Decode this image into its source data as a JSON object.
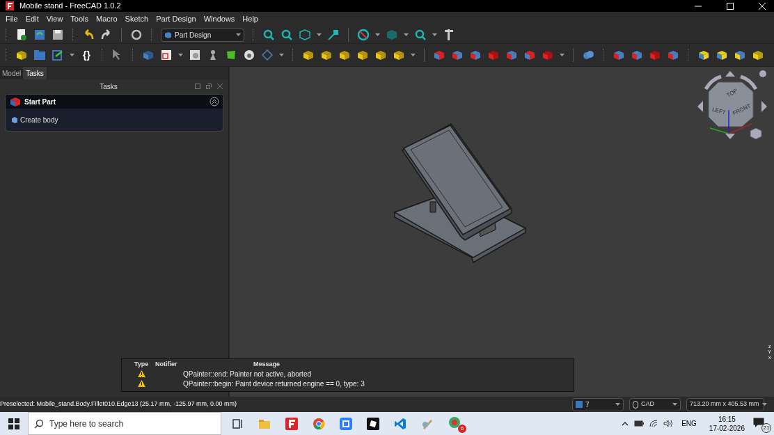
{
  "window": {
    "title": "Mobile stand - FreeCAD 1.0.2"
  },
  "menu": [
    "File",
    "Edit",
    "View",
    "Tools",
    "Macro",
    "Sketch",
    "Part Design",
    "Windows",
    "Help"
  ],
  "workbench": {
    "value": "Part Design"
  },
  "macro_button": "{}",
  "combo_tabs": [
    {
      "label": "Model",
      "selected": false
    },
    {
      "label": "Tasks",
      "selected": true
    }
  ],
  "task_panel": {
    "title": "Tasks",
    "box_title": "Start Part",
    "expanded": true,
    "action": "Create body"
  },
  "navigation_cube": {
    "faces": [
      "TOP",
      "LEFT",
      "FRONT"
    ]
  },
  "axis_labels": [
    "z",
    "Y",
    "x"
  ],
  "report": {
    "columns": [
      "Type",
      "Notifier",
      "Message"
    ],
    "rows": [
      {
        "kind": "warning",
        "message": "QPainter::end: Painter not active, aborted"
      },
      {
        "kind": "warning",
        "message": "QPainter::begin: Paint device returned engine == 0, type: 3"
      }
    ]
  },
  "status_bar": {
    "preselected": "Preselected: Mobile_stand.Body.Fillet010.Edge13 (25.17 mm, -125.97 mm, 0.00 mm)",
    "layer": "7",
    "nav_style": "CAD",
    "dimensions": "713.20 mm x 405.53 mm"
  },
  "taskbar": {
    "search_placeholder": "Type here to search",
    "badge": "6",
    "language": "ENG",
    "time": "16:15",
    "date": "17-02-2026",
    "notifications": "21"
  }
}
